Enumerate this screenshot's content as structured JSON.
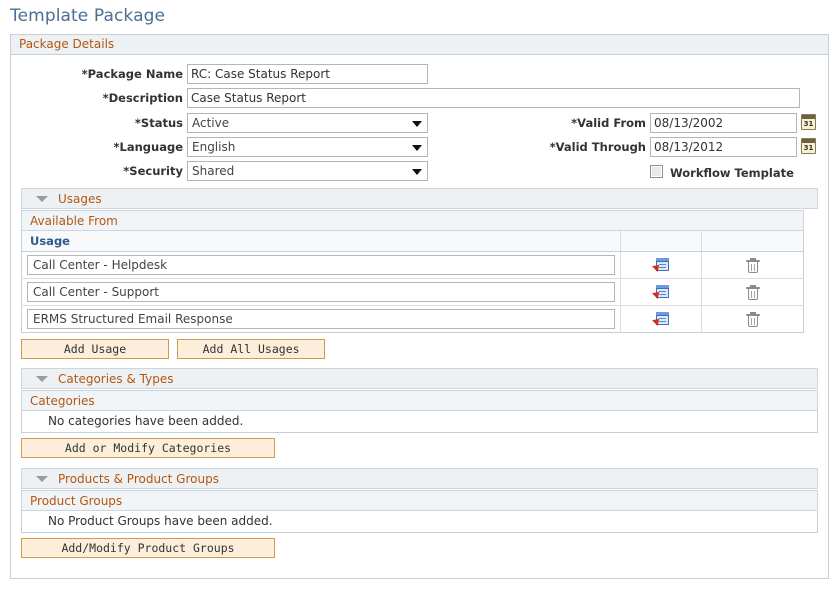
{
  "page": {
    "title": "Template Package"
  },
  "package_details": {
    "header": "Package Details",
    "fields": {
      "package_name": {
        "label": "*Package Name",
        "value": "RC: Case Status Report"
      },
      "description": {
        "label": "*Description",
        "value": "Case Status Report"
      },
      "status": {
        "label": "*Status",
        "value": "Active"
      },
      "language": {
        "label": "*Language",
        "value": "English"
      },
      "security": {
        "label": "*Security",
        "value": "Shared"
      },
      "valid_from": {
        "label": "*Valid From",
        "value": "08/13/2002",
        "icon": "calendar-icon",
        "icon_text": "31"
      },
      "valid_through": {
        "label": "*Valid Through",
        "value": "08/13/2012",
        "icon": "calendar-icon",
        "icon_text": "31"
      },
      "workflow_template": {
        "label": "Workflow Template",
        "checked": false
      }
    }
  },
  "usages": {
    "section_title": "Usages",
    "sub_header": "Available From",
    "columns": [
      "Usage",
      "",
      ""
    ],
    "rows": [
      {
        "usage": "Call Center - Helpdesk",
        "detail_icon": "new-window-icon",
        "delete_icon": "trash-icon"
      },
      {
        "usage": "Call Center - Support",
        "detail_icon": "new-window-icon",
        "delete_icon": "trash-icon"
      },
      {
        "usage": "ERMS Structured Email Response",
        "detail_icon": "new-window-icon",
        "delete_icon": "trash-icon"
      }
    ],
    "buttons": {
      "add_usage": "Add Usage",
      "add_all_usages": "Add All Usages"
    }
  },
  "categories": {
    "section_title": "Categories & Types",
    "sub_header": "Categories",
    "empty_message": "No categories have been added.",
    "button": "Add or Modify Categories"
  },
  "products": {
    "section_title": "Products & Product Groups",
    "sub_header": "Product Groups",
    "empty_message": "No Product Groups have been added.",
    "button": "Add/Modify Product Groups"
  },
  "colors": {
    "title": "#4a6f94",
    "header_text": "#b35712",
    "header_bg": "#eef1f4",
    "column_header_text": "#2e5a8e",
    "button_bg": "#fceedb",
    "button_border": "#d09a4e",
    "panel_border": "#c6cfd8"
  }
}
